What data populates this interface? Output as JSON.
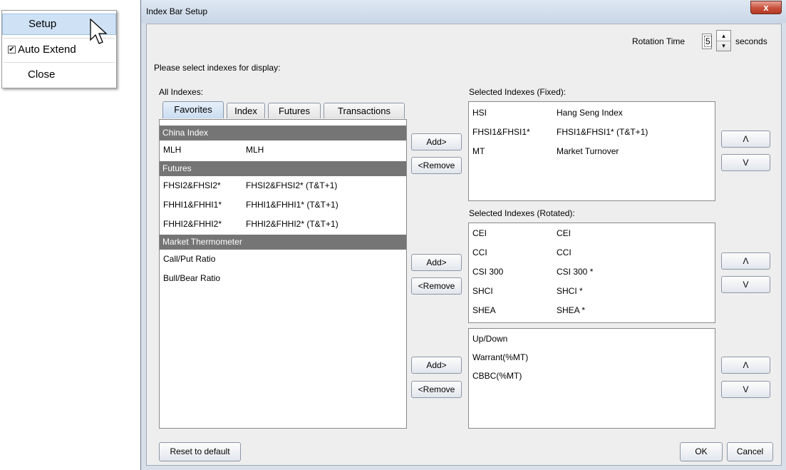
{
  "context_menu": {
    "items": [
      {
        "label": "Setup"
      },
      {
        "label": "Auto Extend",
        "checked": true
      },
      {
        "label": "Close"
      }
    ]
  },
  "window": {
    "title": "Index Bar Setup",
    "close_symbol": "x"
  },
  "rotation": {
    "label": "Rotation Time",
    "value": "5",
    "unit": "seconds"
  },
  "prompt": "Please select indexes for display:",
  "all_indexes": {
    "label": "All Indexes:",
    "tabs": [
      "Favorites",
      "Index",
      "Futures",
      "Transactions"
    ],
    "active_tab": "Favorites",
    "groups": [
      {
        "name": "China Index",
        "items": [
          {
            "code": "MLH",
            "name": "MLH"
          }
        ]
      },
      {
        "name": "Futures",
        "items": [
          {
            "code": "FHSI2&FHSI2*",
            "name": "FHSI2&FHSI2* (T&T+1)"
          },
          {
            "code": "FHHI1&FHHI1*",
            "name": "FHHI1&FHHI1* (T&T+1)"
          },
          {
            "code": "FHHI2&FHHI2*",
            "name": "FHHI2&FHHI2* (T&T+1)"
          }
        ]
      },
      {
        "name": "Market Thermometer",
        "items": [
          {
            "code": "Call/Put Ratio",
            "name": ""
          },
          {
            "code": "Bull/Bear Ratio",
            "name": ""
          }
        ]
      }
    ]
  },
  "buttons": {
    "add": "Add>",
    "remove": "<Remove",
    "up": "Λ",
    "down": "V",
    "reset": "Reset to default",
    "ok": "OK",
    "cancel": "Cancel"
  },
  "fixed": {
    "label": "Selected Indexes (Fixed):",
    "rows": [
      {
        "code": "HSI",
        "name": "Hang Seng Index"
      },
      {
        "code": "FHSI1&FHSI1*",
        "name": "FHSI1&FHSI1* (T&T+1)"
      },
      {
        "code": "MT",
        "name": "Market Turnover"
      }
    ]
  },
  "rotated": {
    "label": "Selected Indexes (Rotated):",
    "rows": [
      {
        "code": "CEI",
        "name": "CEI"
      },
      {
        "code": "CCI",
        "name": "CCI"
      },
      {
        "code": "CSI 300",
        "name": "CSI 300 *"
      },
      {
        "code": "SHCI",
        "name": "SHCI *"
      },
      {
        "code": "SHEA",
        "name": "SHEA *"
      }
    ]
  },
  "thermometer": {
    "rows": [
      {
        "code": "Up/Down"
      },
      {
        "code": "Warrant(%MT)"
      },
      {
        "code": "CBBC(%MT)"
      }
    ]
  }
}
